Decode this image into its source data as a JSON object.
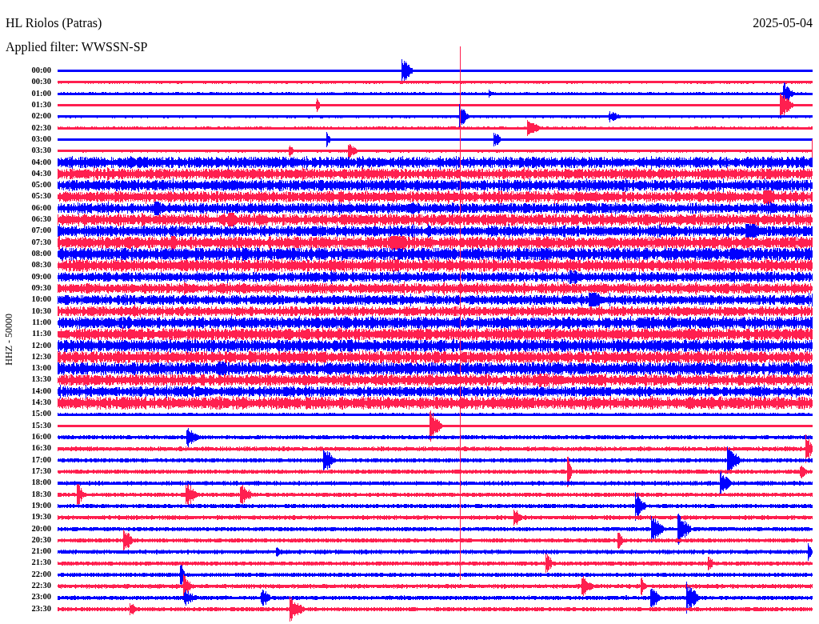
{
  "header": {
    "station": "HL Riolos (Patras)",
    "date": "2025-05-04",
    "filter": "Applied filter: WWSSN-SP"
  },
  "axis_label": "HHZ - 50000",
  "rows": [
    {
      "time": "00:00",
      "color": "#0000ff"
    },
    {
      "time": "00:30",
      "color": "#ff1f4f"
    },
    {
      "time": "01:00",
      "color": "#0000ff"
    },
    {
      "time": "01:30",
      "color": "#ff1f4f"
    },
    {
      "time": "02:00",
      "color": "#0000ff"
    },
    {
      "time": "02:30",
      "color": "#ff1f4f"
    },
    {
      "time": "03:00",
      "color": "#0000ff"
    },
    {
      "time": "03:30",
      "color": "#ff1f4f"
    },
    {
      "time": "04:00",
      "color": "#0000ff"
    },
    {
      "time": "04:30",
      "color": "#ff1f4f"
    },
    {
      "time": "05:00",
      "color": "#0000ff"
    },
    {
      "time": "05:30",
      "color": "#ff1f4f"
    },
    {
      "time": "06:00",
      "color": "#0000ff"
    },
    {
      "time": "06:30",
      "color": "#ff1f4f"
    },
    {
      "time": "07:00",
      "color": "#0000ff"
    },
    {
      "time": "07:30",
      "color": "#ff1f4f"
    },
    {
      "time": "08:00",
      "color": "#0000ff"
    },
    {
      "time": "08:30",
      "color": "#ff1f4f"
    },
    {
      "time": "09:00",
      "color": "#0000ff"
    },
    {
      "time": "09:30",
      "color": "#ff1f4f"
    },
    {
      "time": "10:00",
      "color": "#0000ff"
    },
    {
      "time": "10:30",
      "color": "#ff1f4f"
    },
    {
      "time": "11:00",
      "color": "#0000ff"
    },
    {
      "time": "11:30",
      "color": "#ff1f4f"
    },
    {
      "time": "12:00",
      "color": "#0000ff"
    },
    {
      "time": "12:30",
      "color": "#ff1f4f"
    },
    {
      "time": "13:00",
      "color": "#0000ff"
    },
    {
      "time": "13:30",
      "color": "#ff1f4f"
    },
    {
      "time": "14:00",
      "color": "#0000ff"
    },
    {
      "time": "14:30",
      "color": "#ff1f4f"
    },
    {
      "time": "15:00",
      "color": "#0000ff"
    },
    {
      "time": "15:30",
      "color": "#ff1f4f"
    },
    {
      "time": "16:00",
      "color": "#0000ff"
    },
    {
      "time": "16:30",
      "color": "#ff1f4f"
    },
    {
      "time": "17:00",
      "color": "#0000ff"
    },
    {
      "time": "17:30",
      "color": "#ff1f4f"
    },
    {
      "time": "18:00",
      "color": "#0000ff"
    },
    {
      "time": "18:30",
      "color": "#ff1f4f"
    },
    {
      "time": "19:00",
      "color": "#0000ff"
    },
    {
      "time": "19:30",
      "color": "#ff1f4f"
    },
    {
      "time": "20:00",
      "color": "#0000ff"
    },
    {
      "time": "20:30",
      "color": "#ff1f4f"
    },
    {
      "time": "21:00",
      "color": "#0000ff"
    },
    {
      "time": "21:30",
      "color": "#ff1f4f"
    },
    {
      "time": "22:00",
      "color": "#0000ff"
    },
    {
      "time": "22:30",
      "color": "#ff1f4f"
    },
    {
      "time": "23:00",
      "color": "#0000ff"
    },
    {
      "time": "23:30",
      "color": "#ff1f4f"
    }
  ]
}
